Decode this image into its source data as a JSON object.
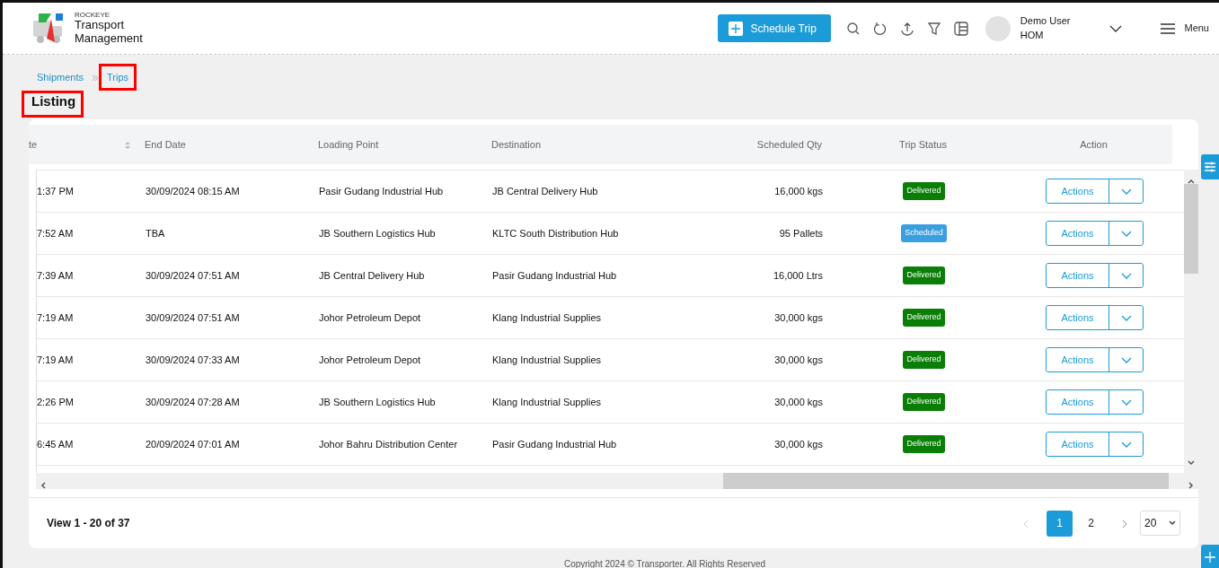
{
  "header": {
    "logo": {
      "brand": "ROCKEYE",
      "title_line_1": "Transport",
      "title_line_2": "Management"
    },
    "schedule_button": "Schedule Trip",
    "user": {
      "name": "Demo User",
      "role": "HOM"
    },
    "menu_label": "Menu"
  },
  "breadcrumb": [
    {
      "label": "Shipments",
      "highlighted": false
    },
    {
      "label": "Trips",
      "highlighted": true
    }
  ],
  "page_title": {
    "text": "Listing",
    "highlighted": true
  },
  "table": {
    "columns": [
      {
        "label": "te",
        "sortable": true
      },
      {
        "label": "End Date",
        "sortable": false
      },
      {
        "label": "Loading Point",
        "sortable": false
      },
      {
        "label": "Destination",
        "sortable": false
      },
      {
        "label": "Scheduled Qty",
        "sortable": false
      },
      {
        "label": "Trip Status",
        "sortable": false
      },
      {
        "label": "Action",
        "sortable": false
      }
    ],
    "rows": [
      {
        "cells": [
          "1:37 PM",
          "30/09/2024 08:15 AM",
          "Pasir Gudang Industrial Hub",
          "JB Central Delivery Hub",
          "16,000 kgs"
        ],
        "status": {
          "label": "Delivered",
          "kind": "delivered"
        },
        "action": "Actions"
      },
      {
        "cells": [
          "7:52 AM",
          "TBA",
          "JB Southern Logistics Hub",
          "KLTC South Distribution Hub",
          "95 Pallets"
        ],
        "status": {
          "label": "Scheduled",
          "kind": "scheduled"
        },
        "action": "Actions"
      },
      {
        "cells": [
          "7:39 AM",
          "30/09/2024 07:51 AM",
          "JB Central Delivery Hub",
          "Pasir Gudang Industrial Hub",
          "16,000 Ltrs"
        ],
        "status": {
          "label": "Delivered",
          "kind": "delivered"
        },
        "action": "Actions"
      },
      {
        "cells": [
          "7:19 AM",
          "30/09/2024 07:51 AM",
          "Johor Petroleum Depot",
          "Klang Industrial Supplies",
          "30,000 kgs"
        ],
        "status": {
          "label": "Delivered",
          "kind": "delivered"
        },
        "action": "Actions"
      },
      {
        "cells": [
          "7:19 AM",
          "30/09/2024 07:33 AM",
          "Johor Petroleum Depot",
          "Klang Industrial Supplies",
          "30,000 kgs"
        ],
        "status": {
          "label": "Delivered",
          "kind": "delivered"
        },
        "action": "Actions"
      },
      {
        "cells": [
          "2:26 PM",
          "30/09/2024 07:28 AM",
          "JB Southern Logistics Hub",
          "Klang Industrial Supplies",
          "30,000 kgs"
        ],
        "status": {
          "label": "Delivered",
          "kind": "delivered"
        },
        "action": "Actions"
      },
      {
        "cells": [
          "6:45 AM",
          "20/09/2024 07:01 AM",
          "Johor Bahru Distribution Center",
          "Pasir Gudang Industrial Hub",
          "30,000 kgs"
        ],
        "status": {
          "label": "Delivered",
          "kind": "delivered"
        },
        "action": "Actions"
      }
    ]
  },
  "pagination": {
    "summary": "View 1 - 20 of 37",
    "pages": [
      {
        "label": "1",
        "selected": true
      },
      {
        "label": "2",
        "selected": false
      }
    ],
    "page_size": "20"
  },
  "footer": "Copyright 2024 © Transporter. All Rights Reserved"
}
